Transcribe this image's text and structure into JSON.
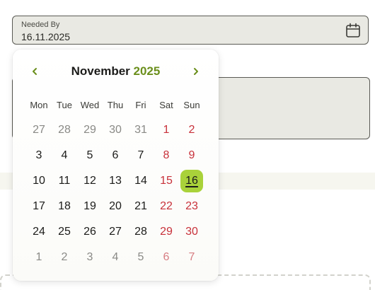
{
  "date_field": {
    "label": "Needed By",
    "value": "16.11.2025",
    "icon": "calendar-icon"
  },
  "calendar": {
    "month": "November",
    "year": "2025",
    "prev_icon": "chevron-left-icon",
    "next_icon": "chevron-right-icon",
    "accent_color": "#6b8f1c",
    "selected_color": "#a9d23a",
    "weekend_color": "#c8313a",
    "weekdays": [
      "Mon",
      "Tue",
      "Wed",
      "Thu",
      "Fri",
      "Sat",
      "Sun"
    ],
    "weeks": [
      [
        {
          "d": "27",
          "m": true
        },
        {
          "d": "28",
          "m": true
        },
        {
          "d": "29",
          "m": true
        },
        {
          "d": "30",
          "m": true
        },
        {
          "d": "31",
          "m": true
        },
        {
          "d": "1",
          "w": true
        },
        {
          "d": "2",
          "w": true
        }
      ],
      [
        {
          "d": "3"
        },
        {
          "d": "4"
        },
        {
          "d": "5"
        },
        {
          "d": "6"
        },
        {
          "d": "7"
        },
        {
          "d": "8",
          "w": true
        },
        {
          "d": "9",
          "w": true
        }
      ],
      [
        {
          "d": "10"
        },
        {
          "d": "11"
        },
        {
          "d": "12"
        },
        {
          "d": "13"
        },
        {
          "d": "14"
        },
        {
          "d": "15",
          "w": true
        },
        {
          "d": "16",
          "w": true,
          "s": true
        }
      ],
      [
        {
          "d": "17"
        },
        {
          "d": "18"
        },
        {
          "d": "19"
        },
        {
          "d": "20"
        },
        {
          "d": "21"
        },
        {
          "d": "22",
          "w": true
        },
        {
          "d": "23",
          "w": true
        }
      ],
      [
        {
          "d": "24"
        },
        {
          "d": "25"
        },
        {
          "d": "26"
        },
        {
          "d": "27"
        },
        {
          "d": "28"
        },
        {
          "d": "29",
          "w": true
        },
        {
          "d": "30",
          "w": true
        }
      ],
      [
        {
          "d": "1",
          "m": true
        },
        {
          "d": "2",
          "m": true
        },
        {
          "d": "3",
          "m": true
        },
        {
          "d": "4",
          "m": true
        },
        {
          "d": "5",
          "m": true
        },
        {
          "d": "6",
          "m": true,
          "w": true
        },
        {
          "d": "7",
          "m": true,
          "w": true
        }
      ]
    ]
  }
}
